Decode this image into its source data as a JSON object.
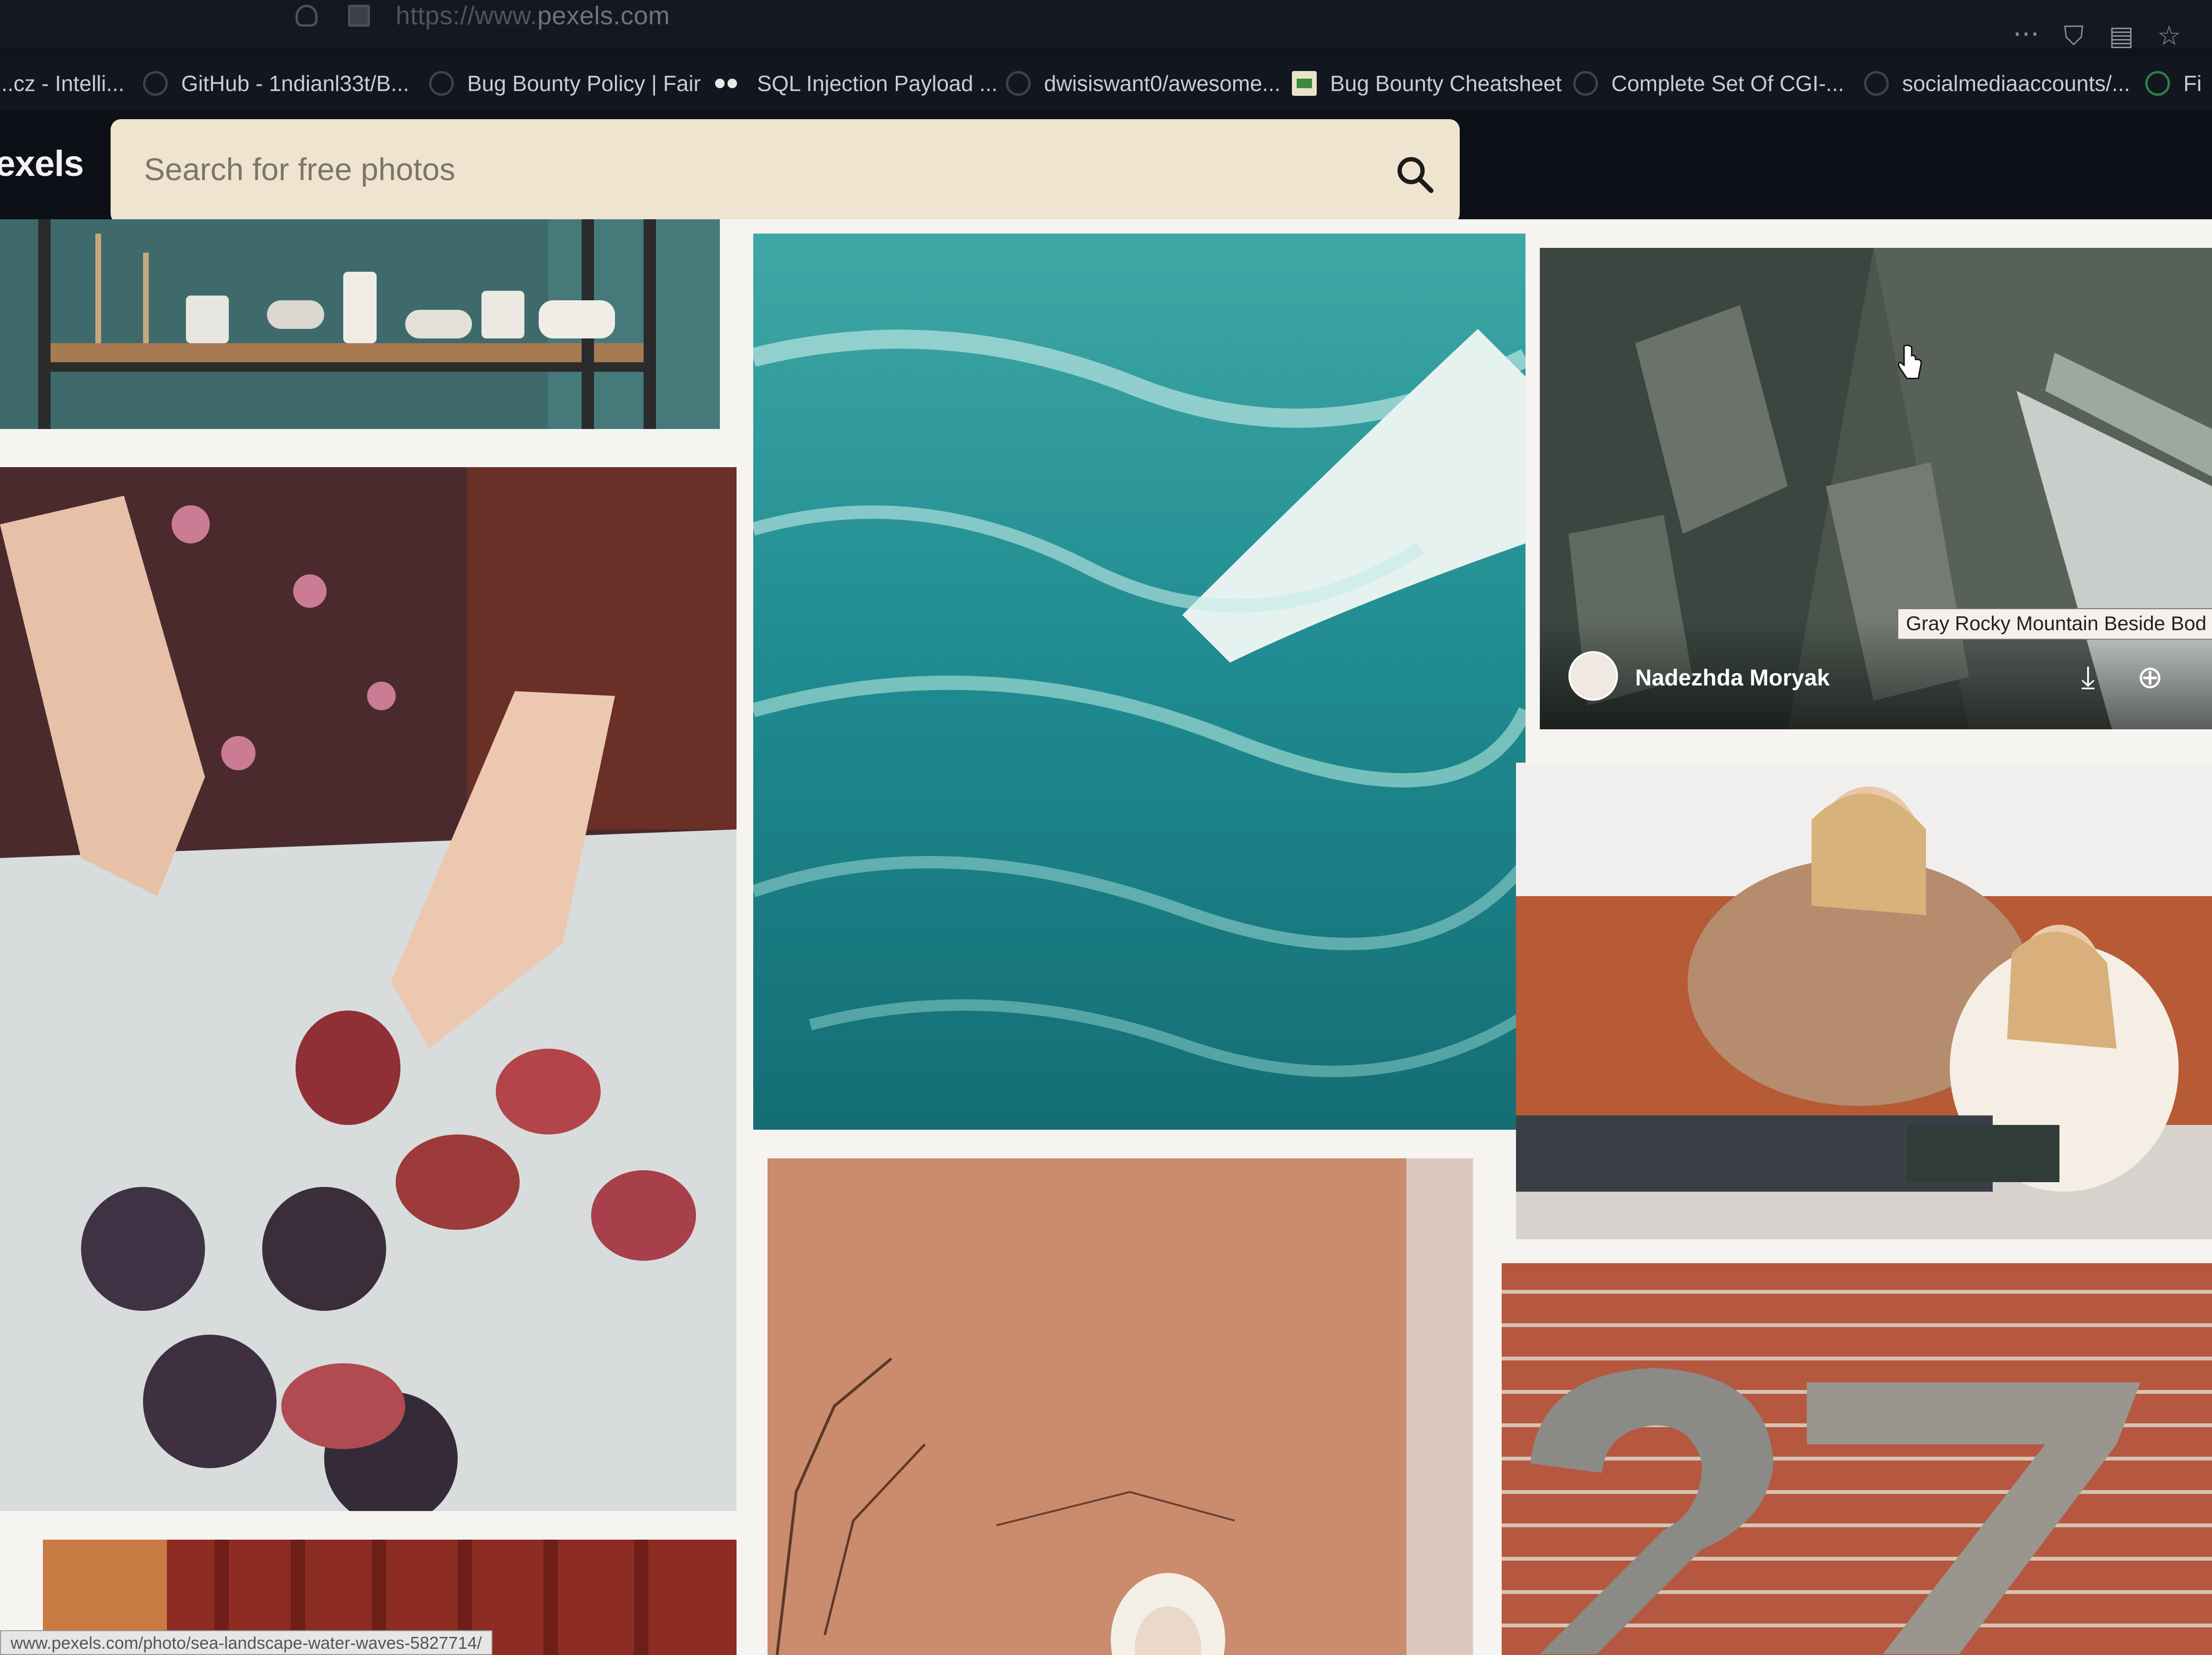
{
  "browser": {
    "url_prefix": "https://www.",
    "url_host": "pexels.com",
    "toolbar_icons": [
      "more-dots-icon",
      "pocket-icon",
      "reader-icon",
      "star-icon"
    ]
  },
  "bookmarks": [
    {
      "label": "...cz - Intelli...",
      "icon": "globe-icon"
    },
    {
      "label": "GitHub - 1ndianl33t/B...",
      "icon": "globe-icon"
    },
    {
      "label": "Bug Bounty Policy | Fair",
      "icon": "globe-icon"
    },
    {
      "label": "SQL Injection Payload ...",
      "icon": "dots-icon"
    },
    {
      "label": "dwisiswant0/awesome...",
      "icon": "globe-icon"
    },
    {
      "label": "Bug Bounty Cheatsheet",
      "icon": "flag-icon"
    },
    {
      "label": "Complete Set Of CGI-...",
      "icon": "globe-icon"
    },
    {
      "label": "socialmediaaccounts/...",
      "icon": "globe-icon"
    },
    {
      "label": "Fi",
      "icon": "globe-icon"
    }
  ],
  "header": {
    "logo": "exels",
    "search_placeholder": "Search for free photos"
  },
  "photos": {
    "cups_shelf": {
      "alt": "shelf with cups"
    },
    "figs": {
      "alt": "hands cutting figs"
    },
    "wave": {
      "alt": "turquoise sea wave"
    },
    "rocky": {
      "tooltip": "Gray Rocky Mountain Beside Bod",
      "author": "Nadezhda Moryak"
    },
    "family": {
      "alt": "mother and daughter on sofa"
    },
    "bricks": {
      "alt": "number 27 on brick wall"
    },
    "terracotta": {
      "alt": "woman against terracotta wall"
    },
    "curtain": {
      "alt": "red curtain"
    }
  },
  "status": {
    "link": "www.pexels.com/photo/sea-landscape-water-waves-5827714/"
  }
}
